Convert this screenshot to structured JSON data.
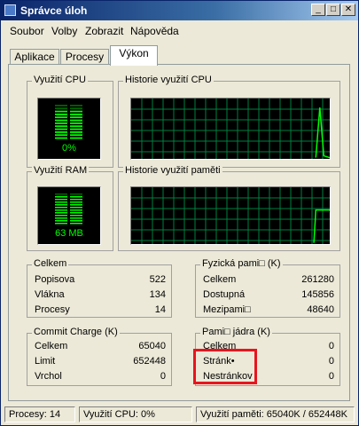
{
  "window": {
    "title": "Správce úloh",
    "controls": {
      "minimize": "_",
      "maximize": "□",
      "close": "✕"
    }
  },
  "menu": [
    "Soubor",
    "Volby",
    "Zobrazit",
    "Nápověda"
  ],
  "tabs": [
    "Aplikace",
    "Procesy",
    "Výkon"
  ],
  "active_tab": "Výkon",
  "cpu_usage": {
    "label": "Využití CPU",
    "value": "0%",
    "level": 0.0
  },
  "cpu_history": {
    "label": "Historie využití CPU"
  },
  "ram_usage": {
    "label": "Využití RAM",
    "value": "63 MB",
    "level": 0.25
  },
  "ram_history": {
    "label": "Historie využití paměti"
  },
  "totals": {
    "label": "Celkem",
    "rows": [
      {
        "k": "Popisova",
        "v": "522"
      },
      {
        "k": "Vlákna",
        "v": "134"
      },
      {
        "k": "Procesy",
        "v": "14"
      }
    ]
  },
  "physical": {
    "label": "Fyzická pami□ (K)",
    "rows": [
      {
        "k": "Celkem",
        "v": "261280"
      },
      {
        "k": "Dostupná",
        "v": "145856"
      },
      {
        "k": "Mezipami□",
        "v": "48640"
      }
    ]
  },
  "commit": {
    "label": "Commit Charge (K)",
    "rows": [
      {
        "k": "Celkem",
        "v": "65040"
      },
      {
        "k": "Limit",
        "v": "652448"
      },
      {
        "k": "Vrchol",
        "v": "0"
      }
    ]
  },
  "kernel": {
    "label": "Pami□ jádra (K)",
    "rows": [
      {
        "k": "Celkem",
        "v": "0"
      },
      {
        "k": "Stránk•",
        "v": "0"
      },
      {
        "k": "Nestránkov",
        "v": "0"
      }
    ]
  },
  "status": {
    "processes": "Procesy: 14",
    "cpu": "Využití CPU:  0%",
    "memory": "Využití paměti: 65040K / 652448K"
  },
  "colors": {
    "graph_green": "#00FF00",
    "grid": "#008040",
    "highlight": "#E8141E"
  }
}
